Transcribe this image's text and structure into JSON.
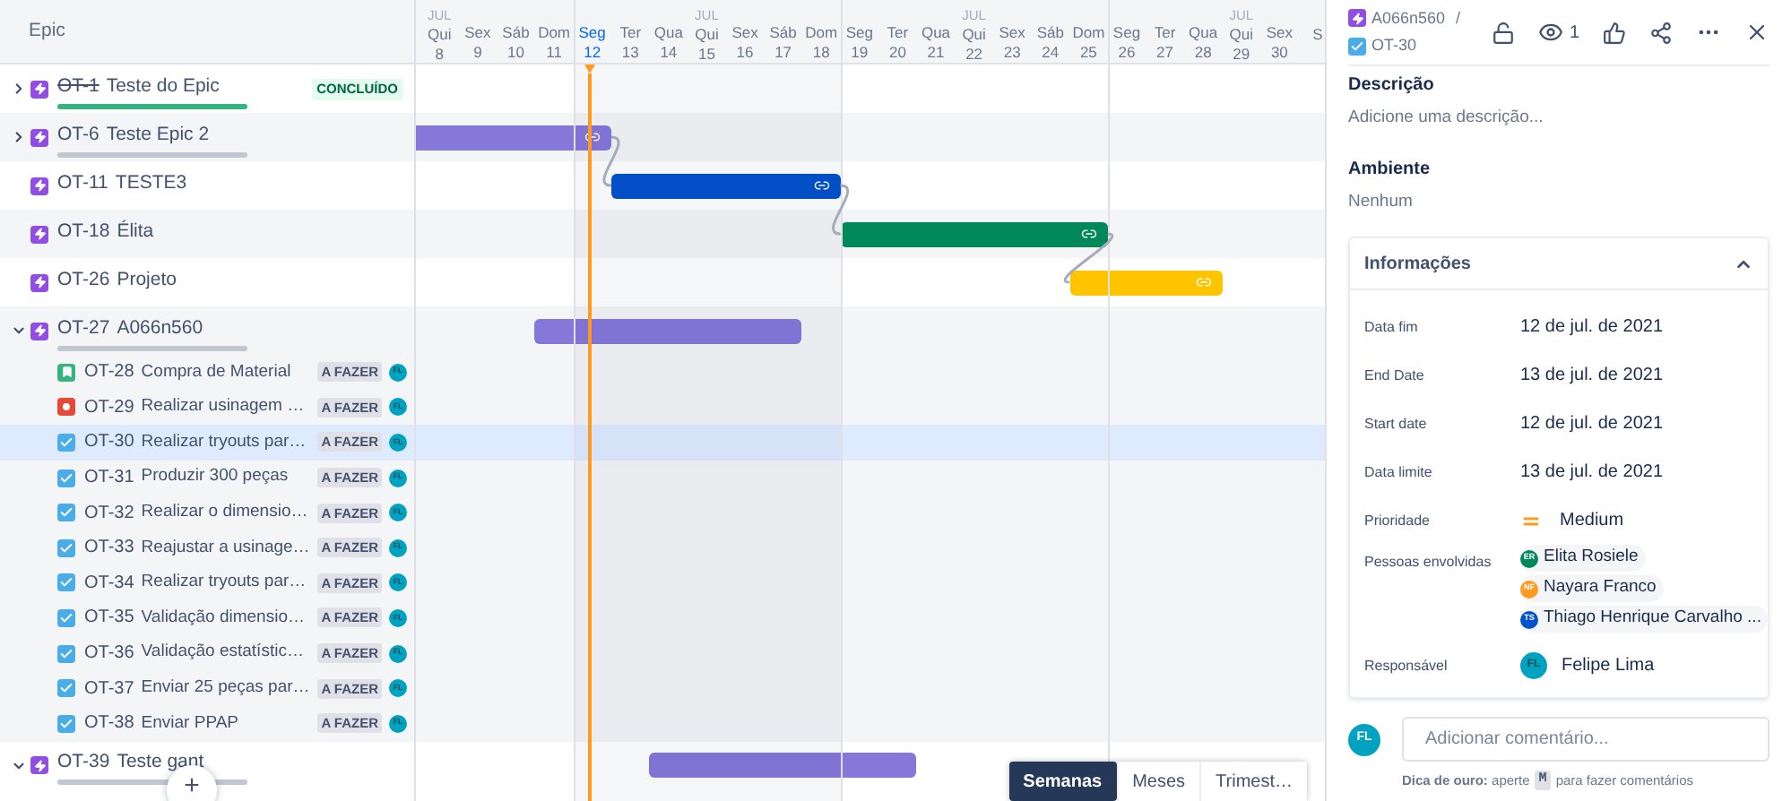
{
  "sidebar": {
    "header": "Epic",
    "add_button": "+",
    "epics": [
      {
        "key": "OT-1",
        "title": "Teste do Epic",
        "done": true,
        "status": "CONCLUÍDO",
        "expanded": false,
        "level": 1,
        "selected": false
      },
      {
        "key": "OT-6",
        "title": "Teste Epic 2",
        "done": false,
        "expanded": false,
        "level": 0,
        "selected": false,
        "bar": {
          "color": "#8777d9",
          "linked": true,
          "connects_next": true
        }
      },
      {
        "key": "OT-11",
        "title": "TESTE3",
        "done": false,
        "selected": false,
        "bar": {
          "color": "#0052cc",
          "linked": true,
          "connects_next": true
        }
      },
      {
        "key": "OT-18",
        "title": "Élita",
        "done": false,
        "selected": false,
        "bar": {
          "color": "#00875a",
          "linked": true,
          "connects_next": true
        }
      },
      {
        "key": "OT-26",
        "title": "Projeto",
        "done": false,
        "selected": false,
        "bar": {
          "color": "#ffc400",
          "linked": true,
          "connects_next": false
        }
      },
      {
        "key": "OT-27",
        "title": "A066n560",
        "done": false,
        "expanded": true,
        "level": 0,
        "selected": false,
        "bar": {
          "color": "#8777d9",
          "linked": false,
          "connects_next": false
        },
        "children": [
          {
            "kind": "story",
            "key": "OT-28",
            "title": "Compra de Material",
            "status": "A FAZER",
            "assignee": "FL",
            "selected": false
          },
          {
            "kind": "bug",
            "key": "OT-29",
            "title": "Realizar usinagem …",
            "status": "A FAZER",
            "assignee": "FL",
            "selected": false
          },
          {
            "kind": "task",
            "key": "OT-30",
            "title": "Realizar tryouts par…",
            "status": "A FAZER",
            "assignee": "FL",
            "selected": true
          },
          {
            "kind": "task",
            "key": "OT-31",
            "title": "Produzir 300 peças",
            "status": "A FAZER",
            "assignee": "FL",
            "selected": false
          },
          {
            "kind": "task",
            "key": "OT-32",
            "title": "Realizar o dimensio…",
            "status": "A FAZER",
            "assignee": "FL",
            "selected": false
          },
          {
            "kind": "task",
            "key": "OT-33",
            "title": "Reajustar a usinage…",
            "status": "A FAZER",
            "assignee": "FL",
            "selected": false
          },
          {
            "kind": "task",
            "key": "OT-34",
            "title": "Realizar tryouts par…",
            "status": "A FAZER",
            "assignee": "FL",
            "selected": false
          },
          {
            "kind": "task",
            "key": "OT-35",
            "title": "Validação dimensio…",
            "status": "A FAZER",
            "assignee": "FL",
            "selected": false
          },
          {
            "kind": "task",
            "key": "OT-36",
            "title": "Validação estatístic…",
            "status": "A FAZER",
            "assignee": "FL",
            "selected": false
          },
          {
            "kind": "task",
            "key": "OT-37",
            "title": "Enviar 25 peças par…",
            "status": "A FAZER",
            "assignee": "FL",
            "selected": false
          },
          {
            "kind": "task",
            "key": "OT-38",
            "title": "Enviar PPAP",
            "status": "A FAZER",
            "assignee": "FL",
            "selected": false
          }
        ]
      },
      {
        "key": "OT-39",
        "title": "Teste gant",
        "done": false,
        "expanded": true,
        "level": 0,
        "selected": false,
        "bar": {
          "color": "#8777d9",
          "linked": false,
          "connects_next": false
        }
      }
    ]
  },
  "timeline": {
    "days": [
      {
        "month": "JUL",
        "weekday": "Qui",
        "day": "8",
        "today": false
      },
      {
        "weekday": "Sex",
        "day": "9",
        "today": false
      },
      {
        "weekday": "Sáb",
        "day": "10",
        "today": false
      },
      {
        "weekday": "Dom",
        "day": "11",
        "today": false
      },
      {
        "weekday": "Seg",
        "day": "12",
        "today": true
      },
      {
        "weekday": "Ter",
        "day": "13",
        "today": false
      },
      {
        "weekday": "Qua",
        "day": "14",
        "today": false
      },
      {
        "month": "JUL",
        "weekday": "Qui",
        "day": "15",
        "today": false
      },
      {
        "weekday": "Sex",
        "day": "16",
        "today": false
      },
      {
        "weekday": "Sáb",
        "day": "17",
        "today": false
      },
      {
        "weekday": "Dom",
        "day": "18",
        "today": false
      },
      {
        "weekday": "Seg",
        "day": "19",
        "today": false
      },
      {
        "weekday": "Ter",
        "day": "20",
        "today": false
      },
      {
        "weekday": "Qua",
        "day": "21",
        "today": false
      },
      {
        "month": "JUL",
        "weekday": "Qui",
        "day": "22",
        "today": false
      },
      {
        "weekday": "Sex",
        "day": "23",
        "today": false
      },
      {
        "weekday": "Sáb",
        "day": "24",
        "today": false
      },
      {
        "weekday": "Dom",
        "day": "25",
        "today": false
      },
      {
        "weekday": "Seg",
        "day": "26",
        "today": false
      },
      {
        "weekday": "Ter",
        "day": "27",
        "today": false
      },
      {
        "weekday": "Qua",
        "day": "28",
        "today": false
      },
      {
        "month": "JUL",
        "weekday": "Qui",
        "day": "29",
        "today": false
      },
      {
        "weekday": "Sex",
        "day": "30",
        "today": false
      },
      {
        "weekday": "S",
        "today": false
      }
    ],
    "views": [
      {
        "label": "Semanas",
        "selected": true
      },
      {
        "label": "Meses",
        "selected": false
      },
      {
        "label": "Trimest…",
        "selected": false
      }
    ]
  },
  "detail": {
    "breadcrumb": [
      {
        "kind": "epic",
        "label": "A066n560"
      },
      {
        "kind": "task",
        "label": "OT-30"
      }
    ],
    "separator": "/",
    "watchers": "1",
    "sections": [
      {
        "heading": "Descrição",
        "text": "Adicione uma descrição..."
      },
      {
        "heading": "Ambiente",
        "text": "Nenhum"
      }
    ],
    "info": {
      "title": "Informações",
      "expanded": true,
      "fields": [
        {
          "kind": "text",
          "label": "Data fim",
          "value": "12 de jul. de 2021"
        },
        {
          "kind": "text",
          "label": "End Date",
          "value": "13 de jul. de 2021"
        },
        {
          "kind": "text",
          "label": "Start date",
          "value": "12 de jul. de 2021"
        },
        {
          "kind": "text",
          "label": "Data limite",
          "value": "13 de jul. de 2021"
        },
        {
          "kind": "priority",
          "label": "Prioridade",
          "value": "Medium",
          "color": "#ff991f"
        },
        {
          "kind": "people",
          "label": "Pessoas envolvidas",
          "people": [
            {
              "initials": "ER",
              "name": "Elita Rosiele",
              "color": "#00875a"
            },
            {
              "initials": "NF",
              "name": "Nayara Franco",
              "color": "#ff991f"
            },
            {
              "initials": "TS",
              "name": "Thiago Henrique Carvalho ...",
              "color": "#0052cc"
            }
          ]
        },
        {
          "kind": "user",
          "label": "Responsável",
          "initials": "FL",
          "value": "Felipe Lima"
        }
      ]
    },
    "comment": {
      "avatar": "FL",
      "placeholder": "Adicionar comentário...",
      "tip": "**Dica de ouro:** aperte",
      "key": "M",
      "tip_after": "para fazer comentários"
    }
  }
}
